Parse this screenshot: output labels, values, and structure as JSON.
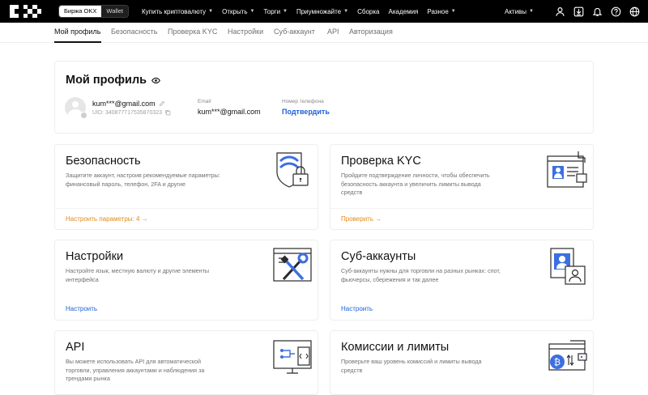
{
  "nav": {
    "switch_exchange": "Биржа OKX",
    "switch_wallet": "Wallet",
    "menu": [
      {
        "label": "Купить криптовалюту",
        "caret": true
      },
      {
        "label": "Открыть",
        "caret": true
      },
      {
        "label": "Торги",
        "caret": true
      },
      {
        "label": "Приумножайте",
        "caret": true
      },
      {
        "label": "Сборка",
        "caret": false
      },
      {
        "label": "Академия",
        "caret": false
      },
      {
        "label": "Разное",
        "caret": true
      }
    ],
    "assets_label": "Активы",
    "icons": [
      "user-icon",
      "download-icon",
      "bell-icon",
      "help-icon",
      "globe-icon"
    ]
  },
  "tabs": [
    {
      "label": "Мой профиль",
      "active": true
    },
    {
      "label": "Безопасность",
      "active": false
    },
    {
      "label": "Проверка KYC",
      "active": false
    },
    {
      "label": "Настройки",
      "active": false
    },
    {
      "label": "Суб-аккаунт",
      "active": false
    },
    {
      "label": "API",
      "active": false
    },
    {
      "label": "Авторизация",
      "active": false
    }
  ],
  "profile": {
    "title": "Мой профиль",
    "username": "kum***@gmail.com",
    "uid": "UID: 340877717535870323",
    "email_label": "Email",
    "email_value": "kum***@gmail.com",
    "phone_label": "Номер телефона",
    "phone_action": "Подтвердить"
  },
  "cards": [
    {
      "title": "Безопасность",
      "description": "Защитите аккаунт, настроив рекомендуемые параметры: финансовый пароль, телефон, 2FA и другие",
      "action": "Настроить параметры: 4 →",
      "action_color": "#e08a1e"
    },
    {
      "title": "Проверка KYC",
      "description": "Пройдите подтверждение личности, чтобы обеспечить безопасность аккаунта и увеличить лимиты вывода средств",
      "action": "Проверить →",
      "action_color": "#e08a1e"
    },
    {
      "title": "Настройки",
      "description": "Настройте язык, местную валюту и другие элементы интерфейса",
      "action": "Настроить",
      "action_color": "#1d5fd6"
    },
    {
      "title": "Суб-аккаунты",
      "description": "Суб-аккаунты нужны для торговли на разных рынках: спот, фьючерсы, сбережения и так далее",
      "action": "Настроить",
      "action_color": "#1d5fd6"
    },
    {
      "title": "API",
      "description": "Вы можете использовать API для автоматической торговли, управления аккаунтами и наблюдения за трендами рынка",
      "action": "",
      "action_color": "#1d5fd6"
    },
    {
      "title": "Комиссии и лимиты",
      "description": "Проверьте ваш уровень комиссий и лимиты вывода средств",
      "action": "",
      "action_color": "#1d5fd6"
    }
  ],
  "colors": {
    "nav_bg": "#000000",
    "link_blue": "#1d5fd6",
    "warning_orange": "#e08a1e",
    "illus_blue": "#3d6fe0"
  }
}
